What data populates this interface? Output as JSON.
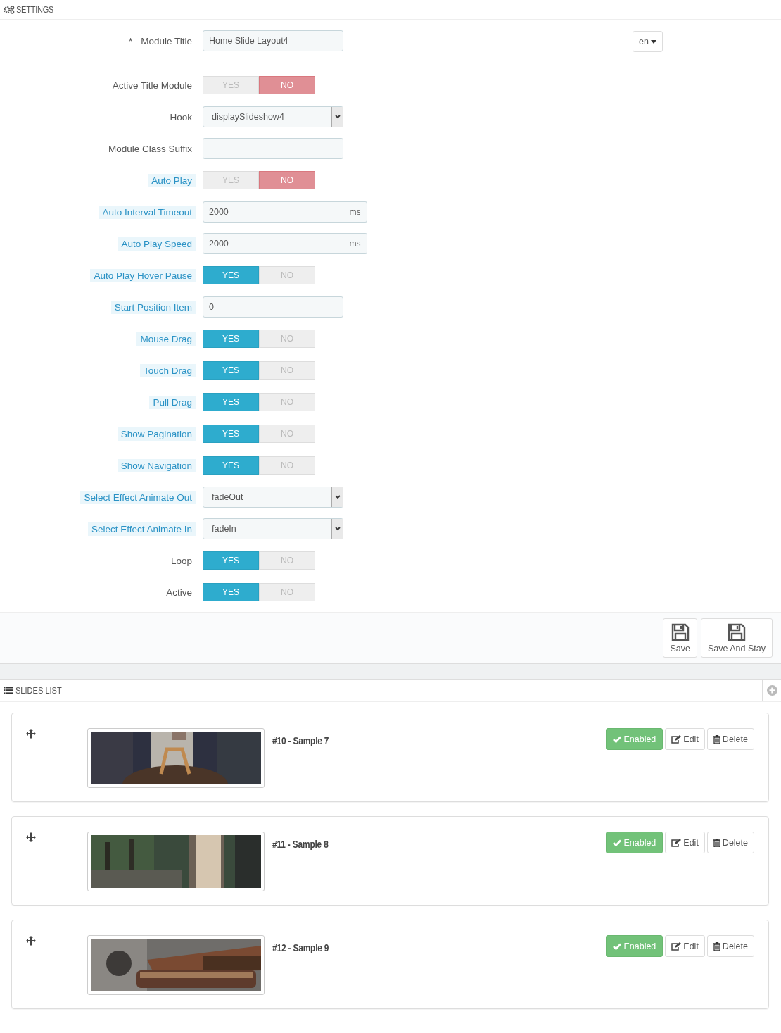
{
  "settings": {
    "title": "SETTINGS",
    "language": "en",
    "fields": [
      {
        "kind": "text",
        "label": "Module Title",
        "required_mark": "*",
        "hint": false,
        "value": "Home Slide Layout4"
      },
      {
        "kind": "toggle",
        "label": "Active Title Module",
        "hint": false,
        "yes": "YES",
        "no": "NO",
        "on": false
      },
      {
        "kind": "select",
        "label": "Hook",
        "hint": false,
        "value": "displaySlideshow4"
      },
      {
        "kind": "text",
        "label": "Module Class Suffix",
        "hint": false
      },
      {
        "kind": "toggle",
        "label": "Auto Play",
        "hint": true,
        "yes": "YES",
        "no": "NO",
        "on": false
      },
      {
        "kind": "addon",
        "label": "Auto Interval Timeout",
        "hint": true,
        "value": "2000",
        "unit": "ms"
      },
      {
        "kind": "addon",
        "label": "Auto Play Speed",
        "hint": true,
        "value": "2000",
        "unit": "ms"
      },
      {
        "kind": "toggle",
        "label": "Auto Play Hover Pause",
        "hint": true,
        "yes": "YES",
        "no": "NO",
        "on": true
      },
      {
        "kind": "text",
        "label": "Start Position Item",
        "hint": true,
        "value": "0"
      },
      {
        "kind": "toggle",
        "label": "Mouse Drag",
        "hint": true,
        "yes": "YES",
        "no": "NO",
        "on": true
      },
      {
        "kind": "toggle",
        "label": "Touch Drag",
        "hint": true,
        "yes": "YES",
        "no": "NO",
        "on": true
      },
      {
        "kind": "toggle",
        "label": "Pull Drag",
        "hint": true,
        "yes": "YES",
        "no": "NO",
        "on": true
      },
      {
        "kind": "toggle",
        "label": "Show Pagination",
        "hint": true,
        "yes": "YES",
        "no": "NO",
        "on": true
      },
      {
        "kind": "toggle",
        "label": "Show Navigation",
        "hint": true,
        "yes": "YES",
        "no": "NO",
        "on": true
      },
      {
        "kind": "select",
        "label": "Select Effect Animate Out",
        "hint": true,
        "value": "fadeOut"
      },
      {
        "kind": "select",
        "label": "Select Effect Animate In",
        "hint": true,
        "value": "fadeIn"
      },
      {
        "kind": "toggle",
        "label": "Loop",
        "hint": false,
        "yes": "YES",
        "no": "NO",
        "on": true
      },
      {
        "kind": "toggle",
        "label": "Active",
        "hint": false,
        "yes": "YES",
        "no": "NO",
        "on": true
      }
    ],
    "buttons": [
      "Save",
      "Save And Stay"
    ]
  },
  "slides_list": {
    "title": "SLIDES LIST",
    "slides": [
      {
        "title": "#10 - Sample 7",
        "status": "Enabled",
        "enabled": true,
        "edit": "Edit",
        "delete": "Delete"
      },
      {
        "title": "#11 - Sample 8",
        "status": "Enabled",
        "enabled": true,
        "edit": "Edit",
        "delete": "Delete"
      },
      {
        "title": "#12 - Sample 9",
        "status": "Enabled",
        "enabled": true,
        "edit": "Edit",
        "delete": "Delete"
      }
    ]
  }
}
